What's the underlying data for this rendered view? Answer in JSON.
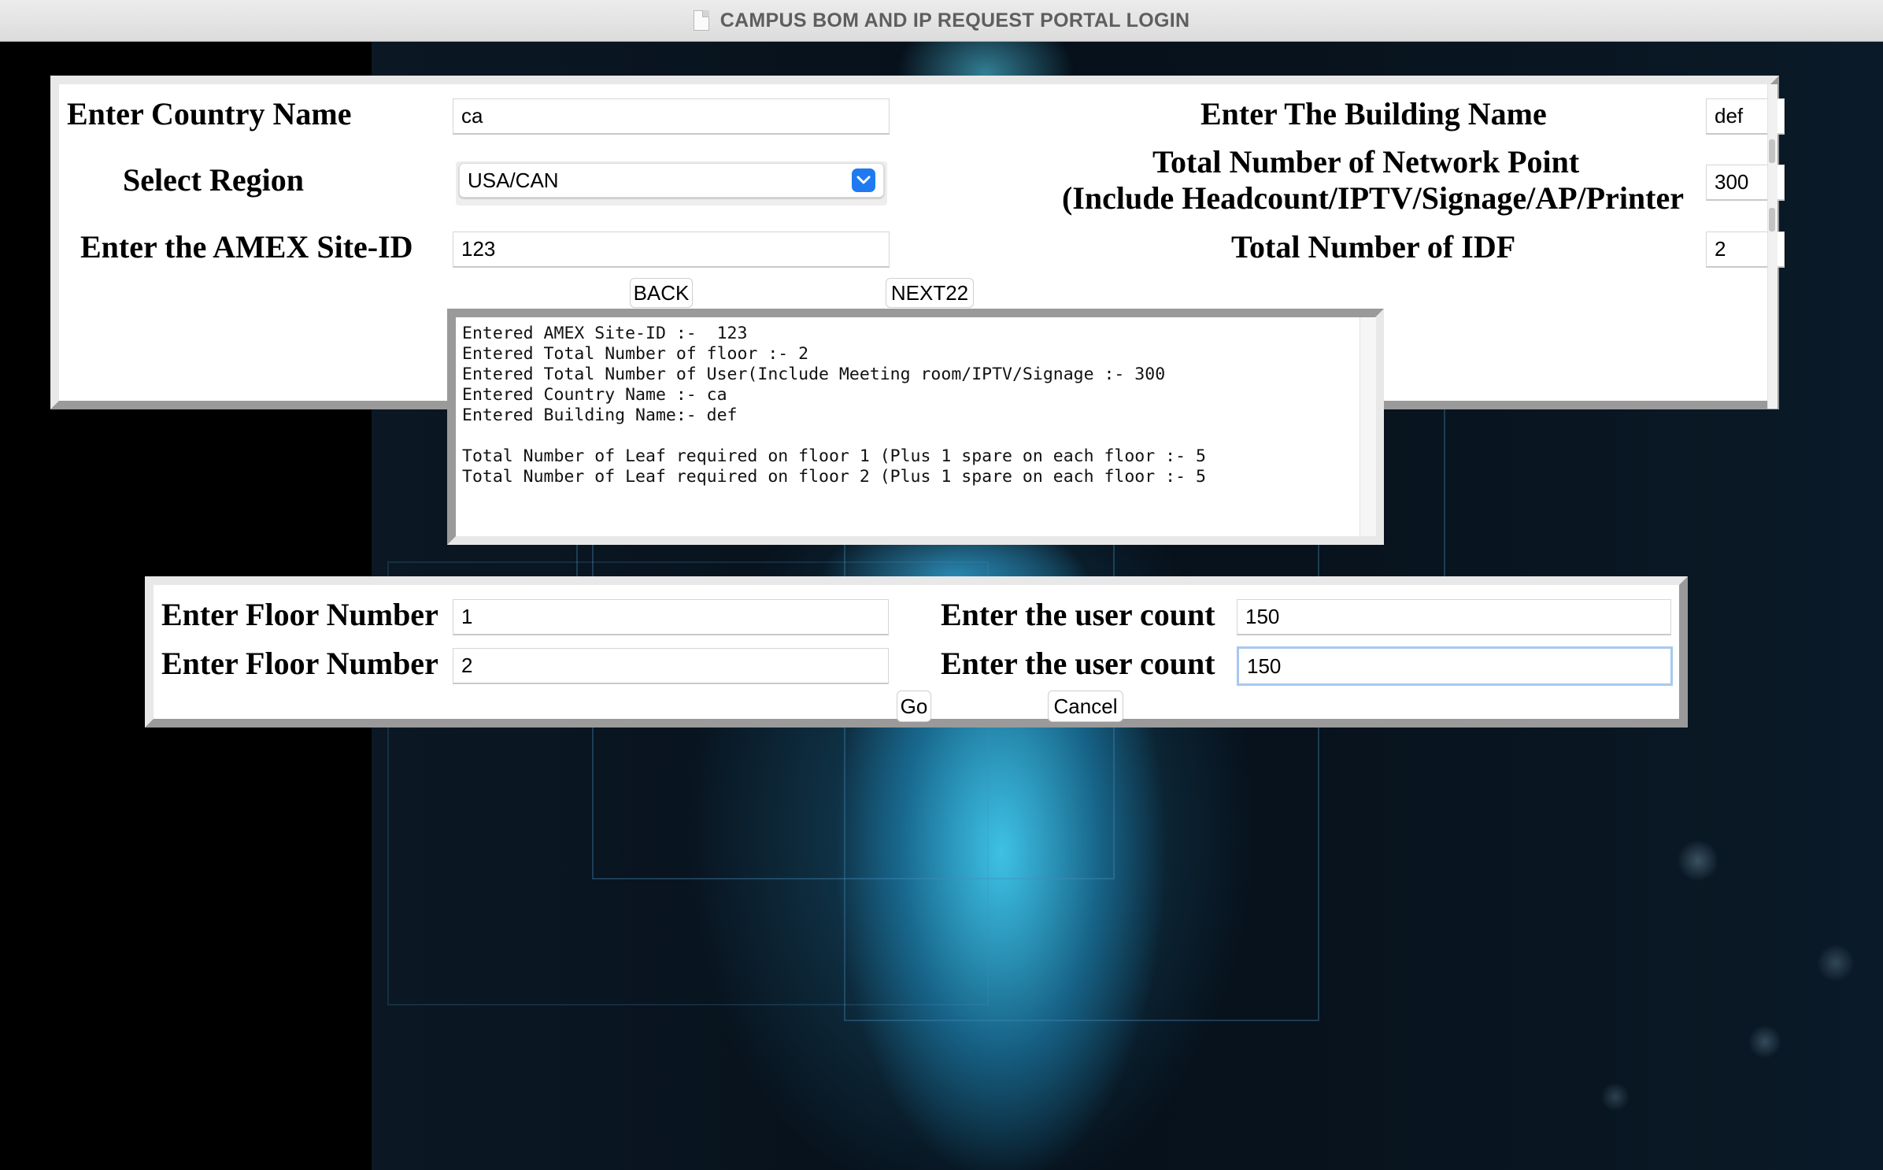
{
  "window": {
    "title": "CAMPUS BOM AND IP REQUEST PORTAL LOGIN"
  },
  "site_form": {
    "country_label": "Enter Country Name",
    "country_value": "ca",
    "region_label": "Select Region",
    "region_value": "USA/CAN",
    "site_id_label": "Enter the AMEX Site-ID",
    "site_id_value": "123",
    "building_label": "Enter The Building Name",
    "building_value": "def",
    "network_point_label_line1": "Total Number of Network Point",
    "network_point_label_line2": "(Include Headcount/IPTV/Signage/AP/Printer",
    "network_point_value": "300",
    "idf_label": "Total Number of IDF",
    "idf_value": "2",
    "back_label": "BACK",
    "next_label": "NEXT22"
  },
  "output_log": {
    "lines": [
      "Entered AMEX Site-ID :-  123",
      "Entered Total Number of floor :- 2",
      "Entered Total Number of User(Include Meeting room/IPTV/Signage :- 300",
      "Entered Country Name :- ca",
      "Entered Building Name:- def",
      "",
      "Total Number of Leaf required on floor 1 (Plus 1 spare on each floor :- 5",
      "Total Number of Leaf required on floor 2 (Plus 1 spare on each floor :- 5"
    ]
  },
  "floor_form": {
    "rows": [
      {
        "floor_label": "Enter Floor Number",
        "floor_value": "1",
        "user_label": "Enter the user count",
        "user_value": "150"
      },
      {
        "floor_label": "Enter Floor Number",
        "floor_value": "2",
        "user_label": "Enter the user count",
        "user_value": "150"
      }
    ],
    "go_label": "Go",
    "cancel_label": "Cancel"
  },
  "icons": {
    "document": "document-icon",
    "select_chevron": "chevron-down-icon"
  },
  "colors": {
    "accent": "#1f7af0",
    "focus_ring": "#a8c8ef",
    "background": "#000000",
    "glow": "#40c8eb"
  }
}
